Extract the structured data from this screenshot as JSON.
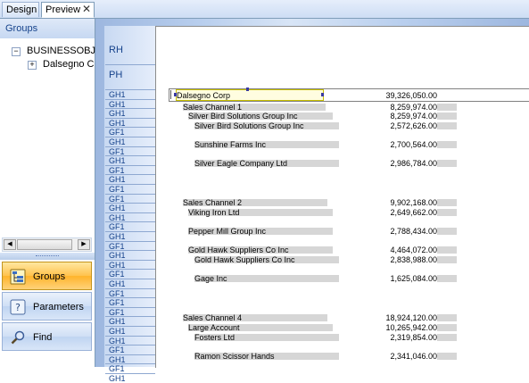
{
  "tabs": [
    {
      "label": "Design"
    },
    {
      "label": "Preview"
    }
  ],
  "tab_close_glyph": "✕",
  "left_panel": {
    "header": "Groups",
    "tree": [
      {
        "expander": "−",
        "label": "BUSINESSOBJ"
      },
      {
        "expander": "+",
        "label": "Dalsegno C"
      }
    ],
    "scroll_left": "◀",
    "scroll_right": "▶"
  },
  "nav_buttons": [
    {
      "label": "Groups",
      "icon": "groups-icon"
    },
    {
      "label": "Parameters",
      "icon": "parameters-icon"
    },
    {
      "label": "Find",
      "icon": "find-icon"
    }
  ],
  "sections": {
    "top": [
      "RH",
      "PH"
    ],
    "rows": [
      "GH1",
      "GH1",
      "GH1",
      "GH1",
      "GF1",
      "GH1",
      "GF1",
      "GH1",
      "GF1",
      "GH1",
      "GF1",
      "GF1",
      "GH1",
      "GH1",
      "GF1",
      "GH1",
      "GF1",
      "GH1",
      "GH1",
      "GF1",
      "GH1",
      "GF1",
      "GF1",
      "GF1",
      "GH1",
      "GH1",
      "GH1",
      "GF1",
      "GH1",
      "GF1",
      "GH1"
    ]
  },
  "report": {
    "company": {
      "name": "Dalsegno Corp",
      "value": "39,326,050.00"
    },
    "rows": [
      {
        "label": "Sales Channel 1",
        "value": "8,259,974.00"
      },
      {
        "label": "Silver Bird Solutions Group Inc",
        "value": "8,259,974.00"
      },
      {
        "label": "Silver Bird Solutions Group Inc",
        "value": "2,572,626.00"
      },
      {
        "label": "Sunshine Farms Inc",
        "value": "2,700,564.00"
      },
      {
        "label": "Silver Eagle Company Ltd",
        "value": "2,986,784.00"
      },
      {
        "label": "Sales Channel 2",
        "value": "9,902,168.00"
      },
      {
        "label": "Viking Iron Ltd",
        "value": "2,649,662.00"
      },
      {
        "label": "Pepper Mill  Group Inc",
        "value": "2,788,434.00"
      },
      {
        "label": "Gold Hawk Suppliers Co Inc",
        "value": "4,464,072.00"
      },
      {
        "label": "Gold Hawk Suppliers Co Inc",
        "value": "2,838,988.00"
      },
      {
        "label": "Gage Inc",
        "value": "1,625,084.00"
      },
      {
        "label": "Sales Channel 4",
        "value": "18,924,120.00"
      },
      {
        "label": "Large Account",
        "value": "10,265,942.00"
      },
      {
        "label": "Fosters  Ltd",
        "value": "2,319,854.00"
      },
      {
        "label": "Ramon Scissor Hands",
        "value": "2,341,046.00"
      }
    ]
  }
}
